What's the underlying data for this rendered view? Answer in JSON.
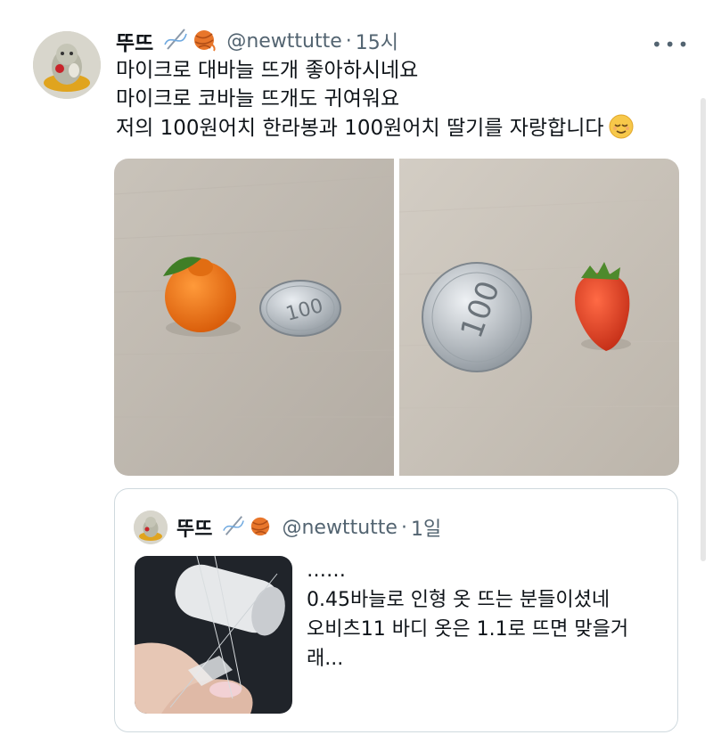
{
  "tweet": {
    "author_name": "뚜뜨",
    "handle": "@newttutte",
    "separator": "·",
    "time": "15시",
    "more_label": "•••",
    "lines": [
      "마이크로 대바늘 뜨개 좋아하시네요",
      "마이크로 코바늘 뜨개도 귀여워요",
      "저의 100원어치 한라봉과 100원어치 딸기를 자랑합니다"
    ],
    "icons": [
      "needle-thread-icon",
      "yarn-ball-icon",
      "relieved-face-emoji"
    ],
    "media": [
      "crochet-hallabong-with-100-won-coin-photo",
      "crochet-strawberry-with-100-won-coin-photo"
    ]
  },
  "quote": {
    "author_name": "뚜뜨",
    "handle": "@newttutte",
    "separator": "·",
    "time": "1일",
    "lines": [
      "……",
      "0.45바늘로 인형 옷 뜨는 분들이셨네",
      "오비츠11 바디 옷은 1.1로 뜨면 맞을거",
      "래..."
    ],
    "media": "micro-knitting-needles-thread-photo"
  },
  "colors": {
    "text": "#0f1419",
    "secondary": "#536471",
    "border": "#cfd9de"
  }
}
